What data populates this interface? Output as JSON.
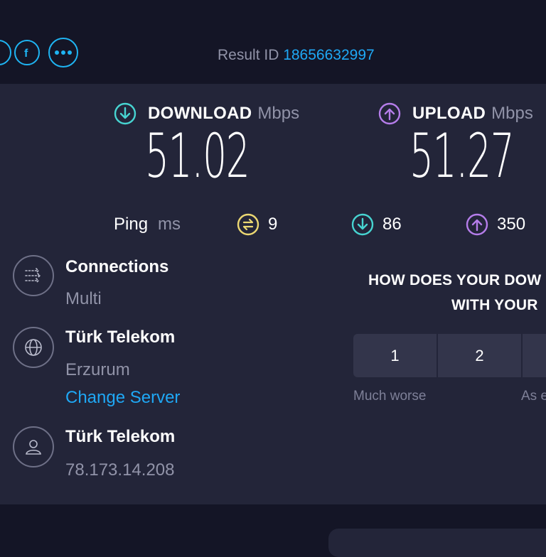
{
  "result": {
    "label": "Result ID",
    "id": "18656632997"
  },
  "download": {
    "label": "DOWNLOAD",
    "unit": "Mbps",
    "value": "51.02"
  },
  "upload": {
    "label": "UPLOAD",
    "unit": "Mbps",
    "value": "51.27"
  },
  "ping": {
    "label": "Ping",
    "unit": "ms",
    "idle": "9",
    "download": "86",
    "upload": "350"
  },
  "connections": {
    "title": "Connections",
    "value": "Multi"
  },
  "server": {
    "name": "Türk Telekom",
    "location": "Erzurum",
    "change_label": "Change Server"
  },
  "provider": {
    "name": "Türk Telekom",
    "ip": "78.173.14.208"
  },
  "survey": {
    "line1": "HOW DOES YOUR DOW",
    "line2": "WITH YOUR",
    "options": [
      "1",
      "2"
    ],
    "caption_left": "Much worse",
    "caption_right": "As e"
  },
  "icons": {
    "share": [
      "share-icon-partial",
      "facebook-icon",
      "more-icon"
    ],
    "download": "download-arrow-icon",
    "upload": "upload-arrow-icon",
    "ping_idle": "ping-idle-icon",
    "connections": "connections-icon",
    "server": "globe-icon",
    "provider": "user-icon"
  },
  "colors": {
    "accent": "#1fa8f5",
    "download": "#47d4d1",
    "upload": "#b57dea",
    "ping": "#ecd872"
  }
}
